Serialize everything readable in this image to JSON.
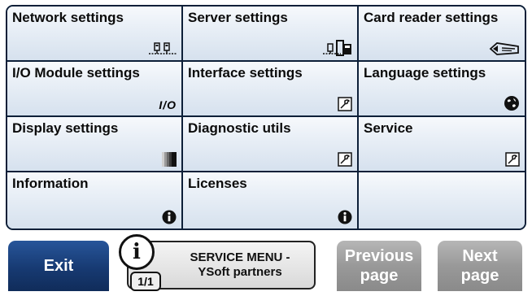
{
  "tiles": [
    {
      "name": "tile-network-settings",
      "label": "Network settings",
      "icon": "network-icon"
    },
    {
      "name": "tile-server-settings",
      "label": "Server settings",
      "icon": "server-icon"
    },
    {
      "name": "tile-card-reader-settings",
      "label": "Card reader settings",
      "icon": "card-reader-icon"
    },
    {
      "name": "tile-io-module-settings",
      "label": "I/O Module settings",
      "icon": "io-icon",
      "icon_text": "I/O"
    },
    {
      "name": "tile-interface-settings",
      "label": "Interface settings",
      "icon": "tool-icon"
    },
    {
      "name": "tile-language-settings",
      "label": "Language settings",
      "icon": "globe-icon"
    },
    {
      "name": "tile-display-settings",
      "label": "Display settings",
      "icon": "display-icon"
    },
    {
      "name": "tile-diagnostic-utils",
      "label": "Diagnostic utils",
      "icon": "tool-icon"
    },
    {
      "name": "tile-service",
      "label": "Service",
      "icon": "tool-icon"
    },
    {
      "name": "tile-information",
      "label": "Information",
      "icon": "info-icon"
    },
    {
      "name": "tile-licenses",
      "label": "Licenses",
      "icon": "info-icon"
    },
    {
      "name": "tile-empty",
      "label": "",
      "icon": ""
    }
  ],
  "footer": {
    "exit_label": "Exit",
    "info_line1": "SERVICE MENU -",
    "info_line2": "YSoft partners",
    "page_indicator": "1/1",
    "prev_line1": "Previous",
    "prev_line2": "page",
    "next_line1": "Next",
    "next_line2": "page"
  },
  "colors": {
    "exit_button": "#173a72",
    "disabled_button": "#999999",
    "tile_border": "#0d1f38"
  }
}
